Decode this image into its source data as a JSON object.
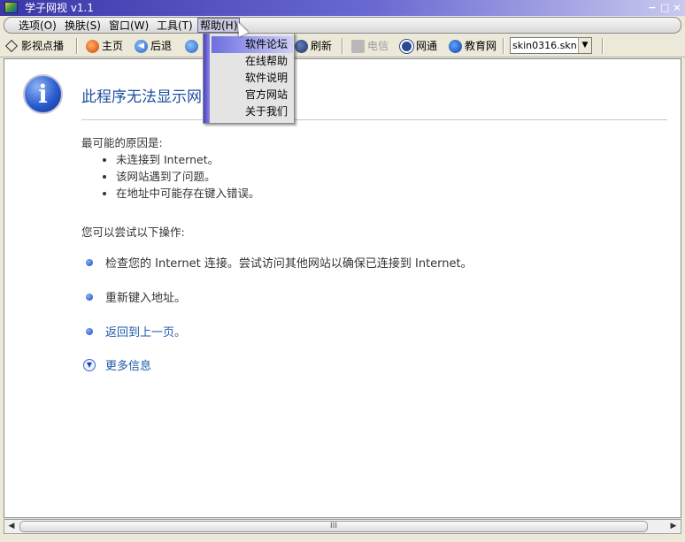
{
  "window": {
    "title": "学子网视 v1.1",
    "minimize": "−",
    "maximize": "□",
    "close": "×"
  },
  "menu": [
    "选项(O)",
    "换肤(S)",
    "窗口(W)",
    "工具(T)",
    "帮助(H)"
  ],
  "help_menu": [
    "软件论坛",
    "在线帮助",
    "软件说明",
    "官方网站",
    "关于我们"
  ],
  "toolbar": {
    "video": "影视点播",
    "home": "主页",
    "back": "后退",
    "refresh": "刷新",
    "telecom": "电信",
    "netcom": "网通",
    "edu": "教育网",
    "skin_select": "skin0316.skn"
  },
  "error_page": {
    "title": "此程序无法显示网页",
    "reasons_head": "最可能的原因是:",
    "reasons": [
      "未连接到 Internet。",
      "该网站遇到了问题。",
      "在地址中可能存在键入错误。"
    ],
    "try_head": "您可以尝试以下操作:",
    "actions": [
      "检查您的 Internet 连接。尝试访问其他网站以确保已连接到 Internet。",
      "重新键入地址。",
      "返回到上一页。"
    ],
    "more": "更多信息"
  },
  "scroll": {
    "left": "◀",
    "right": "▶",
    "grip": "III"
  },
  "colors": {
    "accent": "#1f5aa8",
    "title_bar": "#3a37a8",
    "menu_highlight": "#6e6ee0"
  }
}
